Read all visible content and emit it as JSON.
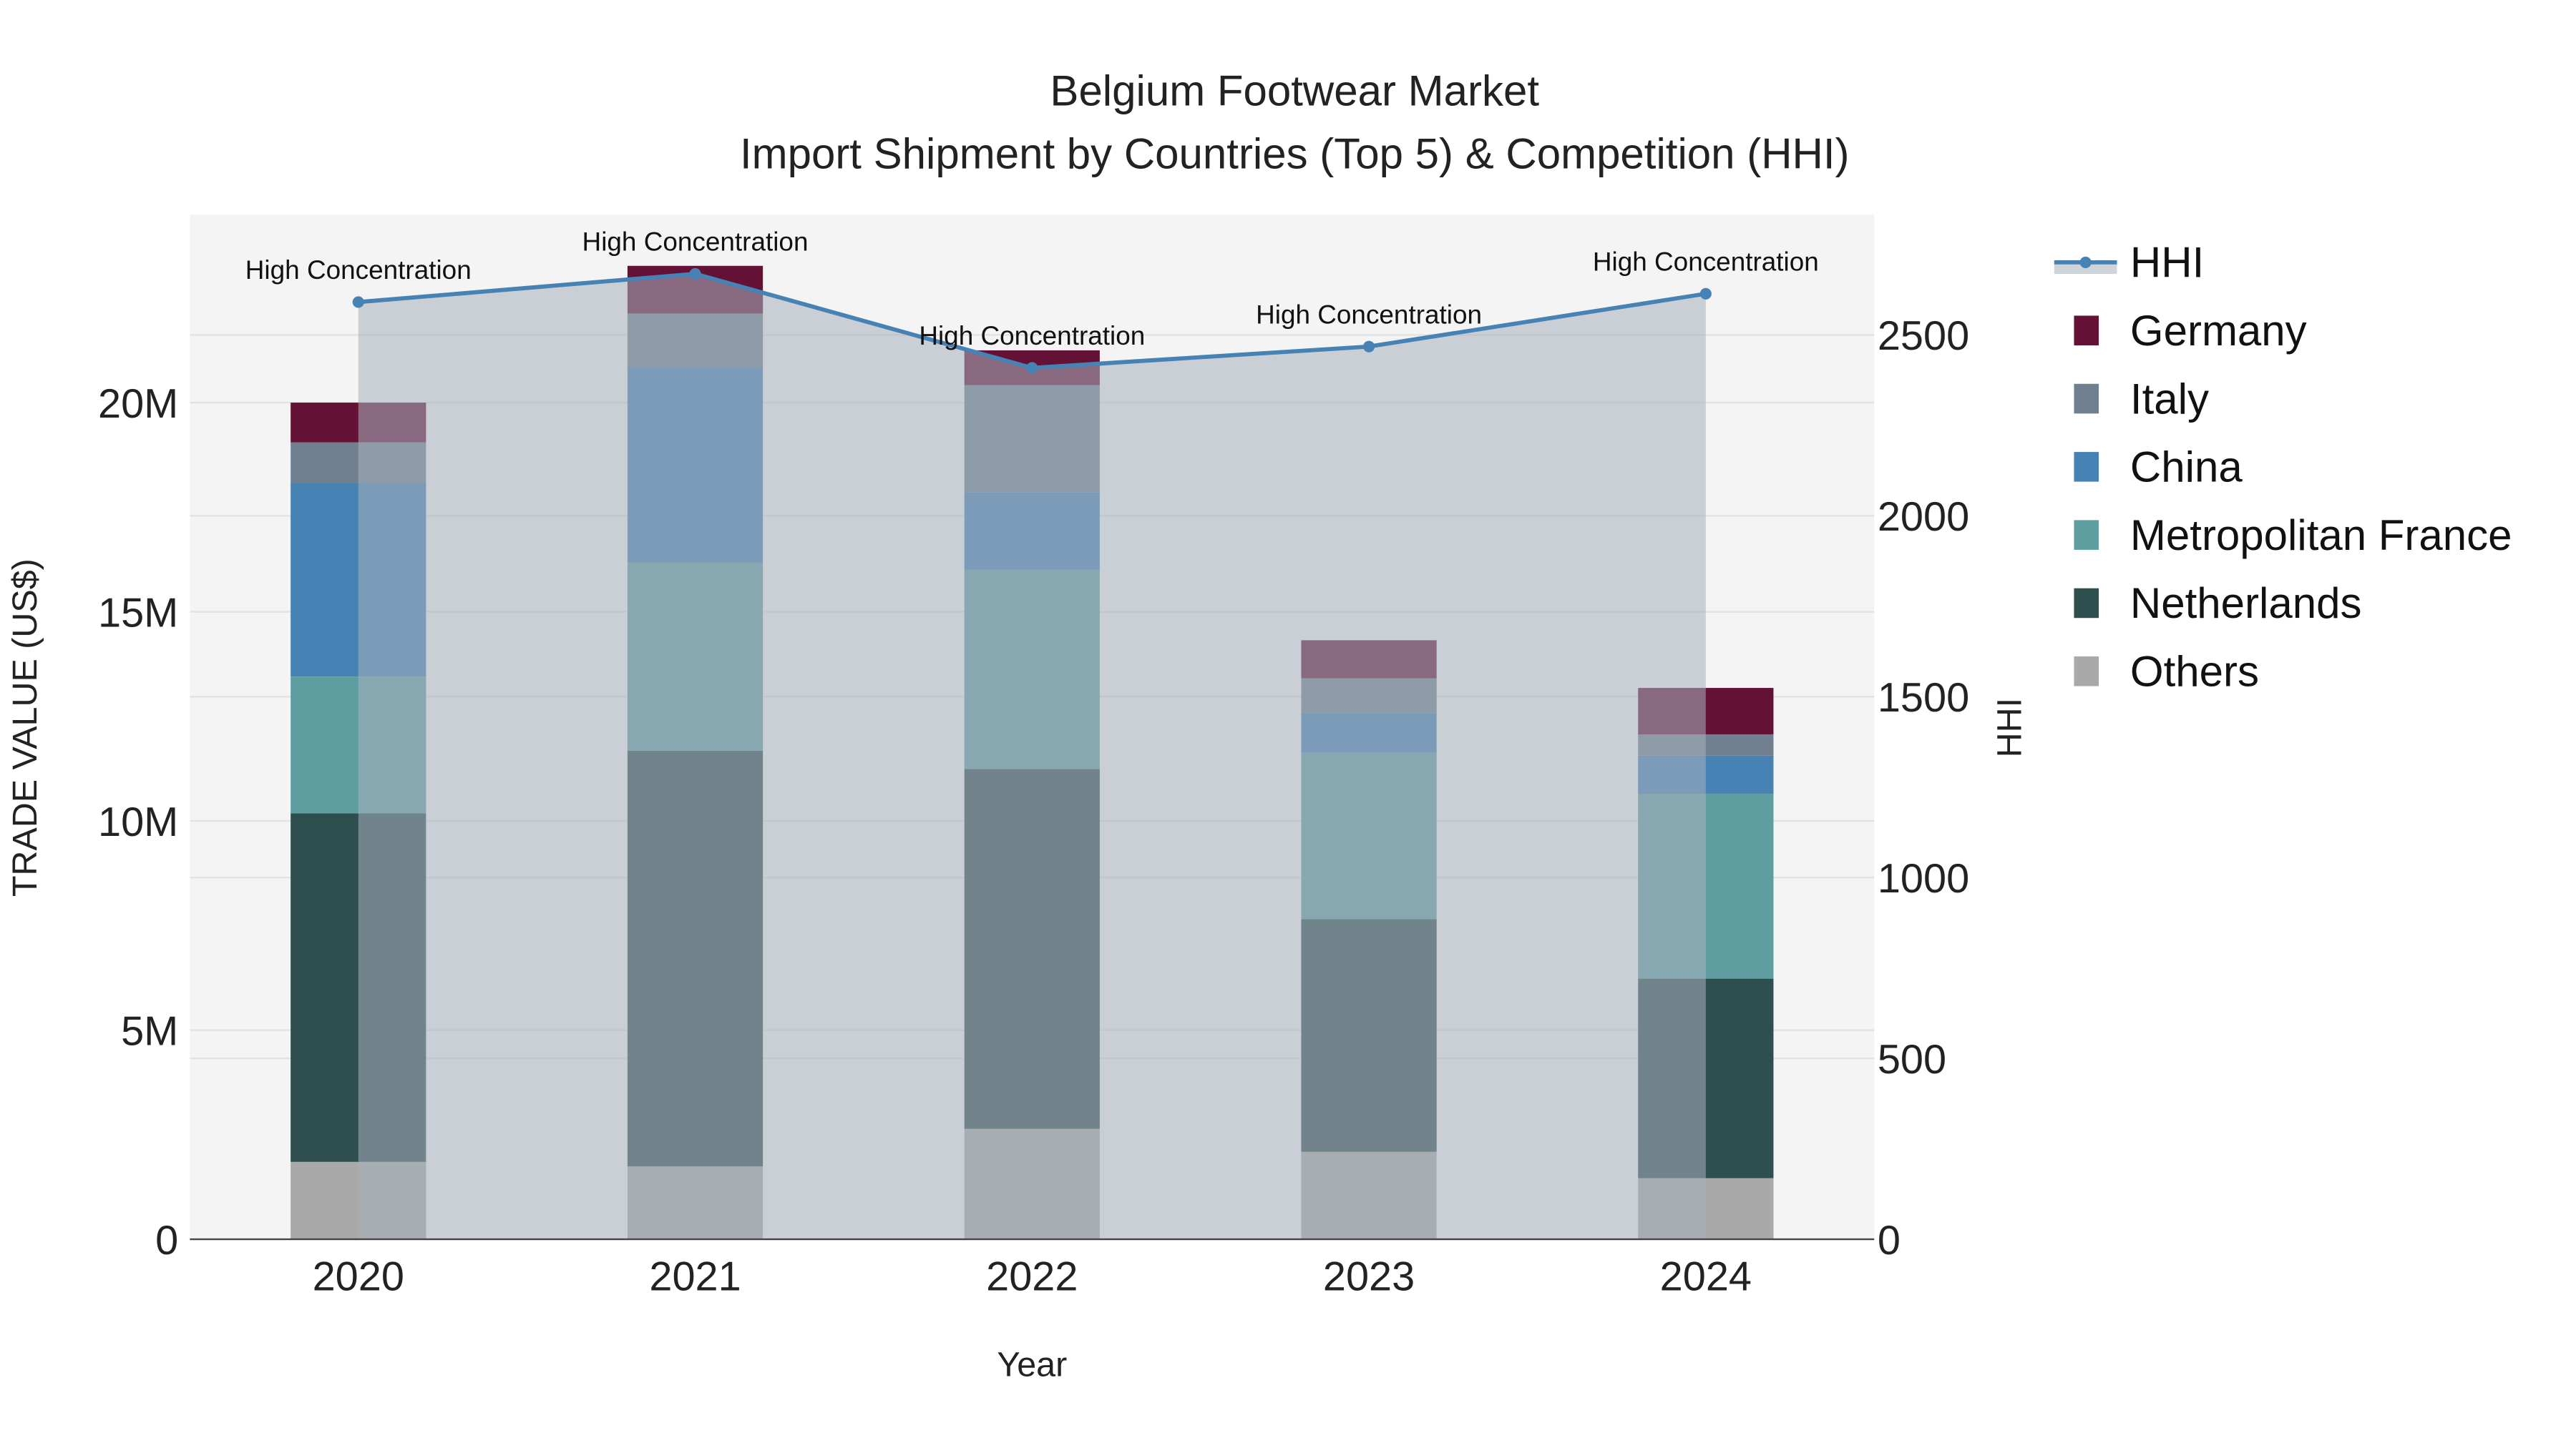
{
  "chart_data": {
    "type": "bar",
    "title": "Belgium Footwear Market",
    "subtitle": "Import Shipment by Countries (Top 5) & Competition (HHI)",
    "xlabel": "Year",
    "ylabel": "TRADE VALUE (US$)",
    "y2label": "HHI",
    "categories": [
      "2020",
      "2021",
      "2022",
      "2023",
      "2024"
    ],
    "ylim": [
      0,
      24500000
    ],
    "y2lim": [
      0,
      2830
    ],
    "yticks": [
      0,
      5000000,
      10000000,
      15000000,
      20000000
    ],
    "ytick_labels": [
      "0",
      "5M",
      "10M",
      "15M",
      "20M"
    ],
    "y2ticks": [
      0,
      500,
      1000,
      1500,
      2000,
      2500
    ],
    "y2tick_labels": [
      "0",
      "500",
      "1000",
      "1500",
      "2000",
      "2500"
    ],
    "stacked": true,
    "series": [
      {
        "name": "Others",
        "color": "#A9A9A9",
        "values": [
          1850000,
          1740000,
          2640000,
          2090000,
          1460000
        ]
      },
      {
        "name": "Netherlands",
        "color": "#2F4F4F",
        "values": [
          8330000,
          9940000,
          8600000,
          5560000,
          4770000
        ]
      },
      {
        "name": "Metropolitan France",
        "color": "#5F9EA0",
        "values": [
          3270000,
          4500000,
          4770000,
          3980000,
          4420000
        ]
      },
      {
        "name": "China",
        "color": "#4682B4",
        "values": [
          4620000,
          4650000,
          1850000,
          950000,
          910000
        ]
      },
      {
        "name": "Italy",
        "color": "#708090",
        "values": [
          980000,
          1300000,
          2560000,
          830000,
          510000
        ]
      },
      {
        "name": "Germany",
        "color": "#631235",
        "values": [
          950000,
          1140000,
          830000,
          910000,
          1110000
        ]
      }
    ],
    "line_series": {
      "name": "HHI",
      "color": "#4682B4",
      "axis": "right",
      "values": [
        2591,
        2669,
        2409,
        2468,
        2614
      ]
    },
    "annotations": [
      "High Concentration",
      "High Concentration",
      "High Concentration",
      "High Concentration",
      "High Concentration"
    ],
    "legend": {
      "placement": "right",
      "items": [
        "HHI",
        "Germany",
        "Italy",
        "China",
        "Metropolitan France",
        "Netherlands",
        "Others"
      ]
    },
    "grid": true
  }
}
